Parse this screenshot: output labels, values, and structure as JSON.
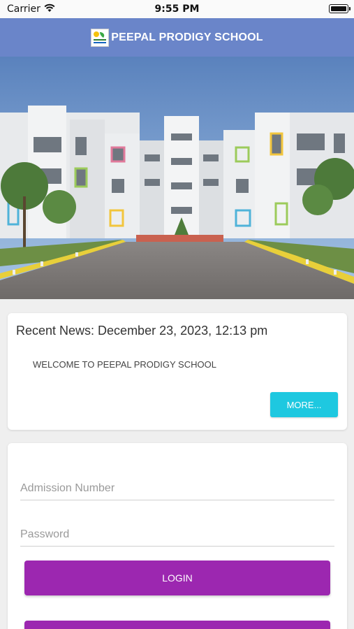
{
  "status_bar": {
    "carrier": "Carrier",
    "time": "9:55 PM"
  },
  "header": {
    "title": "PEEPAL PRODIGY SCHOOL",
    "logo_text": "PEEPAL"
  },
  "news": {
    "title": "Recent News: December 23, 2023, 12:13 pm",
    "items": [
      "WELCOME TO PEEPAL PRODIGY SCHOOL"
    ],
    "more_label": "MORE..."
  },
  "login": {
    "admission_placeholder": "Admission Number",
    "password_placeholder": "Password",
    "login_label": "LOGIN"
  },
  "colors": {
    "header": "#6a85c9",
    "more_button": "#1ec8e0",
    "login_button": "#9c27b0"
  }
}
